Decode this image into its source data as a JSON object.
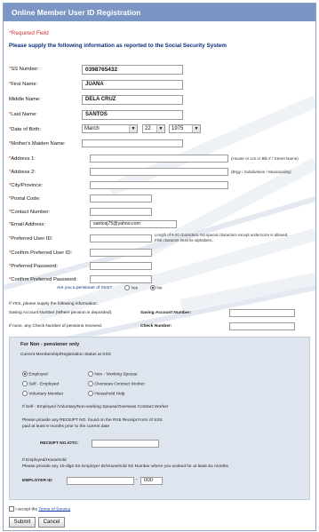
{
  "title": "Online Member User ID Registration",
  "required_note": "*Required Field",
  "intro": "Please supply the following information as reported to the Social Security System",
  "fields": {
    "ss_number": {
      "label": "SS Number:",
      "value": "0398765432"
    },
    "first_name": {
      "label": "First Name:",
      "value": "JUANA"
    },
    "middle_name": {
      "label": "Middle Name:",
      "value": "DELA CRUZ"
    },
    "last_name": {
      "label": "Last Name:",
      "value": "SANTOS"
    },
    "dob": {
      "label": "Date of Birth:",
      "month": "March",
      "day": "22",
      "year": "1975"
    },
    "mothers_maiden": {
      "label": "Mother's Maiden Name:",
      "value": ""
    },
    "address1": {
      "label": "Address 1:",
      "value": "",
      "hint": "(House or Lot or Blk # / Street Name)"
    },
    "address2": {
      "label": "Address 2:",
      "value": "",
      "hint": "(Brgy / Subdivision / Municipality)"
    },
    "city": {
      "label": "City/Province:",
      "value": ""
    },
    "postal": {
      "label": "Postal Code:",
      "value": ""
    },
    "contact": {
      "label": "Contact Number:",
      "value": ""
    },
    "email": {
      "label": "Email Address:",
      "value": "santosj75@yahoo.com"
    },
    "pref_user": {
      "label": "Preferred User ID:",
      "value": "",
      "hint1": "Length of 6-20 characters. No special characters except underscore is allowed.",
      "hint2": "First character must be alphabetic."
    },
    "confirm_user": {
      "label": "Confirm Preferred User ID:",
      "value": ""
    },
    "pref_pass": {
      "label": "Preferred Password:",
      "value": ""
    },
    "confirm_pass": {
      "label": "Confirm Preferred Password:",
      "value": ""
    }
  },
  "pensioner": {
    "question": "Are you a pensioner of SSS?",
    "yes": "Yes",
    "no": "No",
    "selected": "No"
  },
  "savings": {
    "heading": "If YES, please supply the following information:",
    "account_label": "Saving Account Number (Where pension is deposited)",
    "account_field_label": "Saving Account Number:",
    "check_label": "If none, any Check Number of pensions received.",
    "check_field_label": "Check Number:"
  },
  "nonpensioner": {
    "heading": "For Non - pensioner only",
    "status_heading": "Current Membership/Registration Status at SSS",
    "options": [
      {
        "label": "Employed",
        "selected": true
      },
      {
        "label": "Non - Working Spouse",
        "selected": false
      },
      {
        "label": "Self - Employed",
        "selected": false
      },
      {
        "label": "Overseas Contract Worker",
        "selected": false
      },
      {
        "label": "Voluntary Member",
        "selected": false
      },
      {
        "label": "Household Help",
        "selected": false
      }
    ],
    "self_note": "If Self - Employed /Voluntary/Non-working Spouse/Overseas Contract Worker",
    "receipt_note1": "Please provide any RECEIPT NO. found on the RS5 Receipt Form of SSS",
    "receipt_note2": "paid at least 6 months prior to the current date",
    "receipt_label": "RECEIPT NO./OTC:",
    "employed_note1": "If Employed/Household",
    "employed_note2": "Please provide any 10-digit SS Employer ID/Household SS Number where you worked for at least six months",
    "employer_label": "EMPLOYER ID:",
    "employer_suffix": "000",
    "employer_dash": "-"
  },
  "terms": {
    "prefix": "I accept the ",
    "link": "Terms of Service"
  },
  "buttons": {
    "submit": "Submit",
    "cancel": "Cancel"
  },
  "colors": {
    "title_bar": "#7b95c4",
    "intro_text": "#0a2d7a",
    "required": "#d03030"
  }
}
